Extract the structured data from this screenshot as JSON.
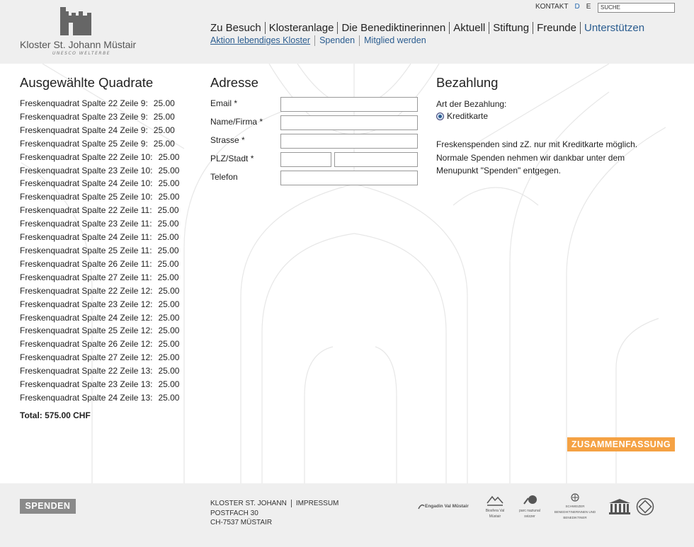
{
  "brand": {
    "name": "Kloster St. Johann Müstair",
    "subtitle": "UNESCO WELTERBE"
  },
  "toplinks": {
    "kontakt": "KONTAKT",
    "lang_d": "D",
    "lang_e": "E",
    "search_value": "SUCHE"
  },
  "mainnav": [
    "Zu Besuch",
    "Klosteranlage",
    "Die Benediktinerinnen",
    "Aktuell",
    "Stiftung",
    "Freunde",
    "Unterstützen"
  ],
  "subnav": [
    "Aktion lebendiges Kloster",
    "Spenden",
    "Mitglied werden"
  ],
  "selected": {
    "title": "Ausgewählte Quadrate",
    "items": [
      {
        "label": "Freskenquadrat Spalte 22 Zeile 9:",
        "price": "25.00"
      },
      {
        "label": "Freskenquadrat Spalte 23 Zeile 9:",
        "price": "25.00"
      },
      {
        "label": "Freskenquadrat Spalte 24 Zeile 9:",
        "price": "25.00"
      },
      {
        "label": "Freskenquadrat Spalte 25 Zeile 9:",
        "price": "25.00"
      },
      {
        "label": "Freskenquadrat Spalte 22 Zeile 10:",
        "price": "25.00"
      },
      {
        "label": "Freskenquadrat Spalte 23 Zeile 10:",
        "price": "25.00"
      },
      {
        "label": "Freskenquadrat Spalte 24 Zeile 10:",
        "price": "25.00"
      },
      {
        "label": "Freskenquadrat Spalte 25 Zeile 10:",
        "price": "25.00"
      },
      {
        "label": "Freskenquadrat Spalte 22 Zeile 11:",
        "price": "25.00"
      },
      {
        "label": "Freskenquadrat Spalte 23 Zeile 11:",
        "price": "25.00"
      },
      {
        "label": "Freskenquadrat Spalte 24 Zeile 11:",
        "price": "25.00"
      },
      {
        "label": "Freskenquadrat Spalte 25 Zeile 11:",
        "price": "25.00"
      },
      {
        "label": "Freskenquadrat Spalte 26 Zeile 11:",
        "price": "25.00"
      },
      {
        "label": "Freskenquadrat Spalte 27 Zeile 11:",
        "price": "25.00"
      },
      {
        "label": "Freskenquadrat Spalte 22 Zeile 12:",
        "price": "25.00"
      },
      {
        "label": "Freskenquadrat Spalte 23 Zeile 12:",
        "price": "25.00"
      },
      {
        "label": "Freskenquadrat Spalte 24 Zeile 12:",
        "price": "25.00"
      },
      {
        "label": "Freskenquadrat Spalte 25 Zeile 12:",
        "price": "25.00"
      },
      {
        "label": "Freskenquadrat Spalte 26 Zeile 12:",
        "price": "25.00"
      },
      {
        "label": "Freskenquadrat Spalte 27 Zeile 12:",
        "price": "25.00"
      },
      {
        "label": "Freskenquadrat Spalte 22 Zeile 13:",
        "price": "25.00"
      },
      {
        "label": "Freskenquadrat Spalte 23 Zeile 13:",
        "price": "25.00"
      },
      {
        "label": "Freskenquadrat Spalte 24 Zeile 13:",
        "price": "25.00"
      }
    ],
    "total": "Total: 575.00 CHF"
  },
  "address": {
    "title": "Adresse",
    "fields": {
      "email": "Email *",
      "name": "Name/Firma *",
      "street": "Strasse *",
      "plz": "PLZ/Stadt *",
      "phone": "Telefon"
    }
  },
  "payment": {
    "title": "Bezahlung",
    "label": "Art der Bezahlung:",
    "option": "Kreditkarte",
    "note": "Freskenspenden sind zZ. nur mit Kreditkarte möglich. Normale Spenden nehmen wir dankbar unter dem Menupunkt \"Spenden\" entgegen."
  },
  "summary_button": "ZUSAMMENFASSUNG",
  "footer": {
    "donate": "SPENDEN",
    "org": "KLOSTER ST. JOHANN",
    "impressum": "IMPRESSUM",
    "postfach": "POSTFACH 30",
    "city": "CH-7537 MÜSTAIR",
    "partners": {
      "engadin": "Engadin Val Müstair",
      "biosfera": "Biosfera Val Müstair",
      "parc": "parc naziunal svizzer",
      "benedictines": "SCHWEIZER BENEDIKTINERINNEN UND BENEDIKTINER"
    }
  },
  "colors": {
    "accent": "#f5a244",
    "link": "#2a5c8f",
    "donate_bg": "#8a8a8a",
    "header_bg": "#efefef"
  }
}
